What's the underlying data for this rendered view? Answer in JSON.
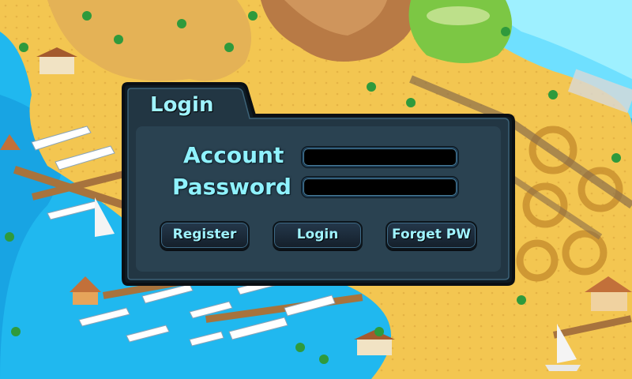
{
  "dialog": {
    "title": "Login",
    "account_label": "Account",
    "password_label": "Password",
    "account_value": "",
    "password_value": "",
    "buttons": {
      "register": "Register",
      "login": "Login",
      "forget": "Forget PW"
    }
  },
  "colors": {
    "sea": "#1fb9f0",
    "sand": "#f5c34a",
    "panel": "#1d2a35",
    "accent_text": "#8ff2ff"
  }
}
